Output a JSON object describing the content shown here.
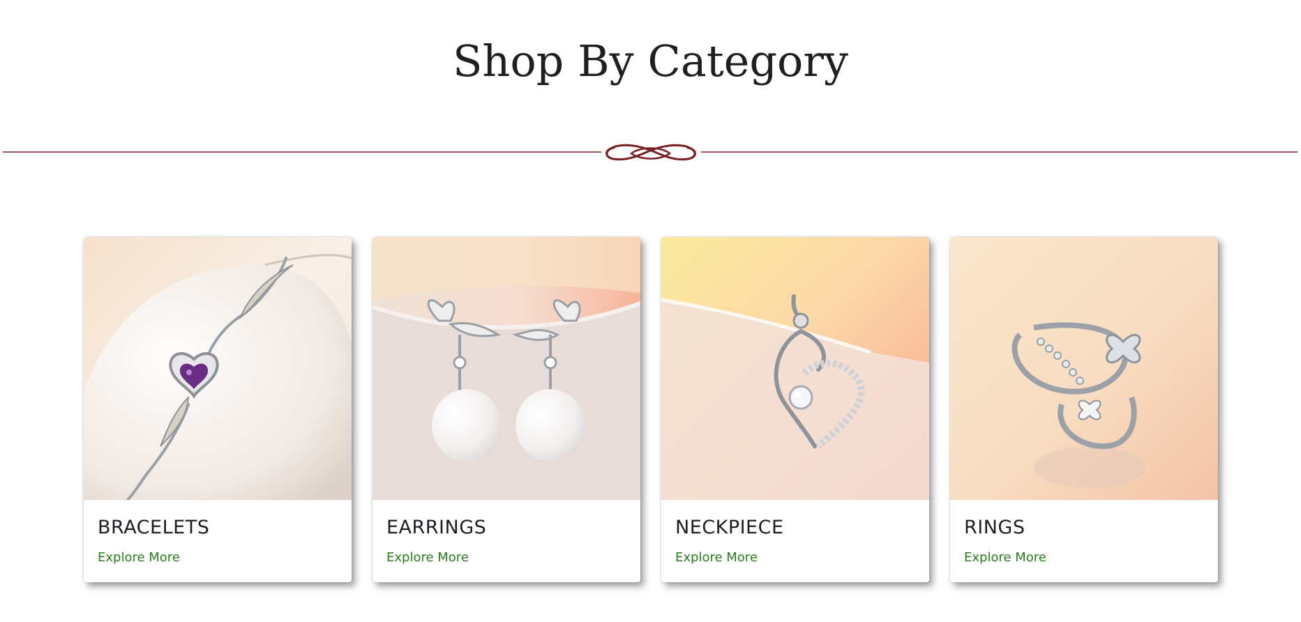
{
  "section": {
    "title": "Shop By Category"
  },
  "colors": {
    "divider": "#7a1f24",
    "link": "#2a7d1c",
    "title": "#1f1f1f"
  },
  "categories": [
    {
      "title": "BRACELETS",
      "link_label": "Explore More",
      "image": "bracelet-image"
    },
    {
      "title": "EARRINGS",
      "link_label": "Explore More",
      "image": "earrings-image"
    },
    {
      "title": "NECKPIECE",
      "link_label": "Explore More",
      "image": "neckpiece-image"
    },
    {
      "title": "RINGS",
      "link_label": "Explore More",
      "image": "ring-image"
    }
  ]
}
